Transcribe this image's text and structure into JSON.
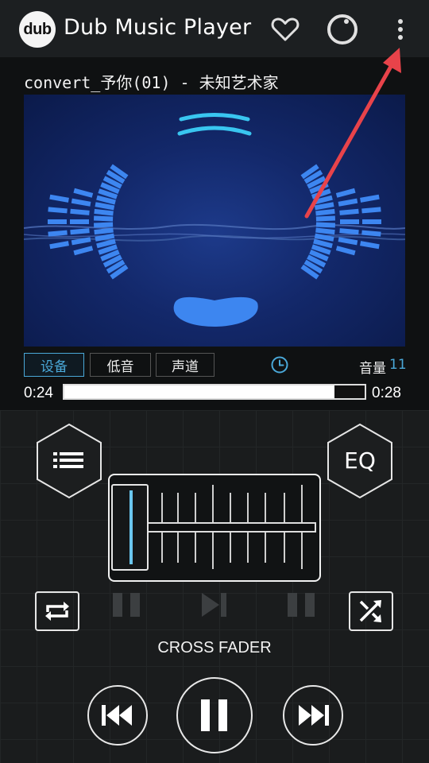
{
  "app": {
    "logo_text": "dub",
    "title": "Dub Music Player"
  },
  "header_icons": [
    "heart-icon",
    "circle-icon",
    "more-vert-icon"
  ],
  "track": {
    "title": "convert_予你(01) - 未知艺术家"
  },
  "tabs": [
    {
      "label": "设备",
      "active": true
    },
    {
      "label": "低音",
      "active": false
    },
    {
      "label": "声道",
      "active": false
    }
  ],
  "volume": {
    "label": "音量",
    "value": "11"
  },
  "progress": {
    "elapsed": "0:24",
    "total": "0:28",
    "fraction": 0.9
  },
  "buttons": {
    "eq_label": "EQ"
  },
  "crossfader": {
    "label": "CROSS FADER",
    "position": 0.0
  },
  "colors": {
    "accent": "#4aa8d8",
    "visualizer_bars": "#3d86f0",
    "arrow": "#e8434a"
  }
}
